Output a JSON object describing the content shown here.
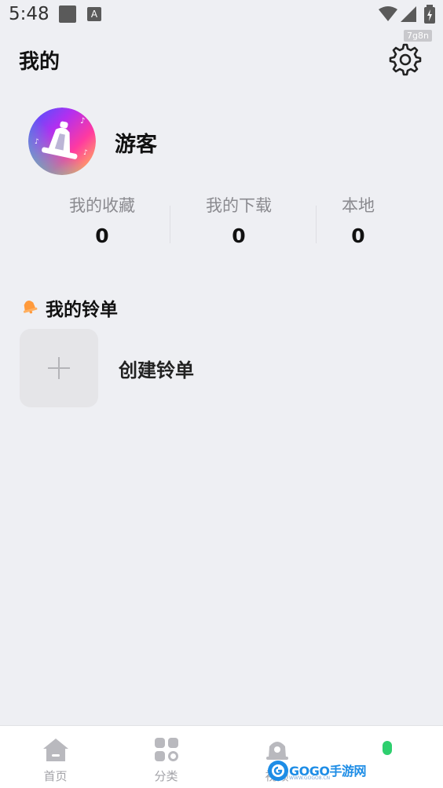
{
  "status_bar": {
    "time": "5:48",
    "icons": [
      "notification-square-icon",
      "a-app-icon",
      "wifi-icon",
      "signal-icon",
      "battery-charging-icon"
    ],
    "tag": "7g8n"
  },
  "header": {
    "title": "我的",
    "settings_icon": "gear-icon"
  },
  "profile": {
    "username": "游客",
    "avatar_icon": "bell-avatar-icon"
  },
  "stats": [
    {
      "label": "我的收藏",
      "value": "0"
    },
    {
      "label": "我的下载",
      "value": "0"
    },
    {
      "label": "本地",
      "value": "0"
    }
  ],
  "section": {
    "title": "我的铃单",
    "icon": "bell-icon",
    "icon_color": "#ff9a3c"
  },
  "create": {
    "label": "创建铃单",
    "icon": "plus-icon"
  },
  "bottom_nav": {
    "items": [
      {
        "label": "首页",
        "icon": "home-icon"
      },
      {
        "label": "分类",
        "icon": "category-icon"
      },
      {
        "label": "视频",
        "icon": "video-bell-icon"
      },
      {
        "label": "",
        "icon": "profile-dot-icon"
      }
    ],
    "active_color": "#2ecf6e"
  },
  "watermark": {
    "text": "GOGO手游网",
    "sub": "WWW.GOGO8.CN"
  }
}
